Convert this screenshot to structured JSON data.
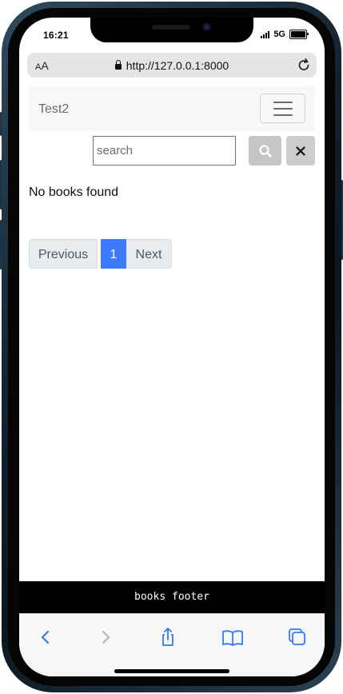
{
  "status_bar": {
    "time": "16:21",
    "network": "5G"
  },
  "browser": {
    "text_size_label_small": "A",
    "text_size_label_large": "A",
    "url": "http://127.0.0.1:8000",
    "icons": [
      "lock-icon",
      "reload-icon"
    ]
  },
  "navbar": {
    "brand": "Test2",
    "toggler_icon": "hamburger-icon"
  },
  "search": {
    "placeholder": "search",
    "value": "",
    "search_icon": "magnifier-icon",
    "clear_icon": "close-icon"
  },
  "main": {
    "empty_message": "No books found"
  },
  "pagination": {
    "previous_label": "Previous",
    "current_page": "1",
    "next_label": "Next"
  },
  "footer": {
    "text": "books footer"
  },
  "toolbar": {
    "icons": [
      "back-icon",
      "forward-icon",
      "share-icon",
      "bookmarks-icon",
      "tabs-icon"
    ]
  },
  "colors": {
    "accent": "#3d7bfd",
    "ios_blue": "#3478f6",
    "footer_bg": "#000000"
  }
}
